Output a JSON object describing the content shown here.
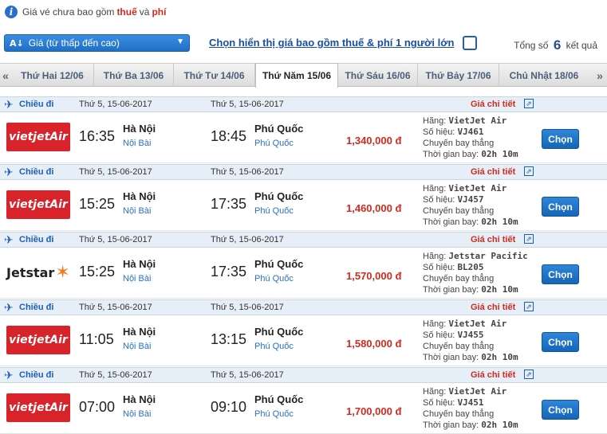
{
  "notice": {
    "prefix": "Giá vé chưa bao gồm",
    "tax": "thuế",
    "and": "và",
    "fee": "phí"
  },
  "sortbar": {
    "sort_label": "Giá (từ thấp đến cao)",
    "include_link": "Chọn hiển thị giá bao gồm thuế & phí 1 người lớn",
    "include_checked": false,
    "total_prefix": "Tổng số",
    "total_count": "6",
    "total_suffix": "kết quả"
  },
  "date_tabs": [
    {
      "label": "Thứ Hai 12/06",
      "active": false
    },
    {
      "label": "Thứ Ba 13/06",
      "active": false
    },
    {
      "label": "Thứ Tư 14/06",
      "active": false
    },
    {
      "label": "Thứ Năm 15/06",
      "active": true
    },
    {
      "label": "Thứ Sáu 16/06",
      "active": false
    },
    {
      "label": "Thứ Bảy 17/06",
      "active": false
    },
    {
      "label": "Chủ Nhật 18/06",
      "active": false
    }
  ],
  "labels": {
    "direction": "Chiều đi",
    "detail": "Giá chi tiết",
    "airline_label": "Hãng:",
    "flight_no_label": "Số hiệu:",
    "duration_label": "Thời gian bay:",
    "choose": "Chọn"
  },
  "flights": [
    {
      "date_dep": "Thứ 5, 15-06-2017",
      "date_arr": "Thứ 5, 15-06-2017",
      "logo": "vietjet-air-logo",
      "logo_text": "vietjetAir",
      "dep_time": "16:35",
      "dep_city": "Hà Nội",
      "dep_airport": "Nội Bài",
      "arr_time": "18:45",
      "arr_city": "Phú Quốc",
      "arr_airport": "Phú Quốc",
      "price": "1,340,000 đ",
      "airline": "VietJet Air",
      "flight_no": "VJ461",
      "type": "Chuyến bay thẳng",
      "duration": "02h 10m"
    },
    {
      "date_dep": "Thứ 5, 15-06-2017",
      "date_arr": "Thứ 5, 15-06-2017",
      "logo": "vietjet-air-logo",
      "logo_text": "vietjetAir",
      "dep_time": "15:25",
      "dep_city": "Hà Nội",
      "dep_airport": "Nội Bài",
      "arr_time": "17:35",
      "arr_city": "Phú Quốc",
      "arr_airport": "Phú Quốc",
      "price": "1,460,000 đ",
      "airline": "VietJet Air",
      "flight_no": "VJ457",
      "type": "Chuyến bay thẳng",
      "duration": "02h 10m"
    },
    {
      "date_dep": "Thứ 5, 15-06-2017",
      "date_arr": "Thứ 5, 15-06-2017",
      "logo": "jetstar-logo",
      "logo_text": "Jetstar",
      "dep_time": "15:25",
      "dep_city": "Hà Nội",
      "dep_airport": "Nội Bài",
      "arr_time": "17:35",
      "arr_city": "Phú Quốc",
      "arr_airport": "Phú Quốc",
      "price": "1,570,000 đ",
      "airline": "Jetstar Pacific",
      "flight_no": "BL205",
      "type": "Chuyến bay thẳng",
      "duration": "02h 10m"
    },
    {
      "date_dep": "Thứ 5, 15-06-2017",
      "date_arr": "Thứ 5, 15-06-2017",
      "logo": "vietjet-air-logo",
      "logo_text": "vietjetAir",
      "dep_time": "11:05",
      "dep_city": "Hà Nội",
      "dep_airport": "Nội Bài",
      "arr_time": "13:15",
      "arr_city": "Phú Quốc",
      "arr_airport": "Phú Quốc",
      "price": "1,580,000 đ",
      "airline": "VietJet Air",
      "flight_no": "VJ455",
      "type": "Chuyến bay thẳng",
      "duration": "02h 10m"
    },
    {
      "date_dep": "Thứ 5, 15-06-2017",
      "date_arr": "Thứ 5, 15-06-2017",
      "logo": "vietjet-air-logo",
      "logo_text": "vietjetAir",
      "dep_time": "07:00",
      "dep_city": "Hà Nội",
      "dep_airport": "Nội Bài",
      "arr_time": "09:10",
      "arr_city": "Phú Quốc",
      "arr_airport": "Phú Quốc",
      "price": "1,700,000 đ",
      "airline": "VietJet Air",
      "flight_no": "VJ451",
      "type": "Chuyến bay thẳng",
      "duration": "02h 10m"
    }
  ],
  "colors": {
    "accent": "#1d5fb4",
    "price": "#d32a1e",
    "vietjet": "#d8232a",
    "jetstar_star": "#f47c20"
  }
}
